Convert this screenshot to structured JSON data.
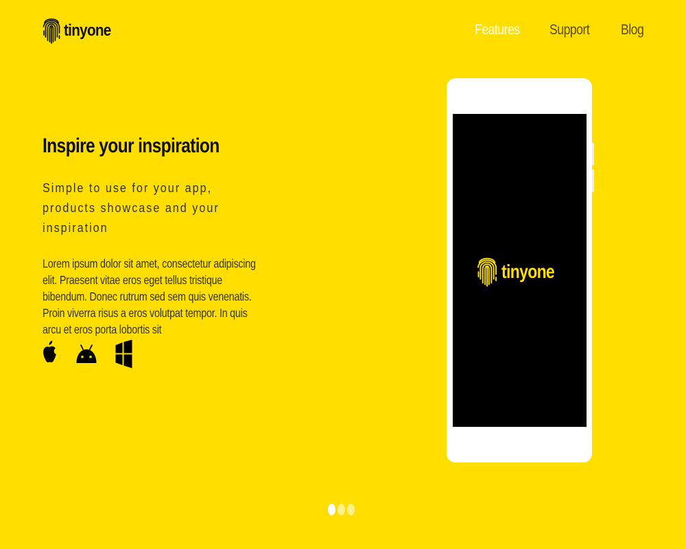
{
  "brand": {
    "name": "tinyone",
    "icon": "fingerprint-icon",
    "color": "#FFDE00"
  },
  "nav": {
    "items": [
      {
        "label": "Features",
        "active": true
      },
      {
        "label": "Support",
        "active": false
      },
      {
        "label": "Blog",
        "active": false
      }
    ]
  },
  "hero": {
    "title": "Inspire your inspiration",
    "subtitle": "Simple to use for your app, products showcase and your inspiration",
    "body": "Lorem ipsum dolor sit amet, consectetur adipiscing elit. Praesent vitae eros eget tellus tristique bibendum. Donec rutrum sed sem quis venenatis. Proin viverra risus a eros volutpat tempor. In quis arcu et eros porta lobortis sit"
  },
  "platforms": [
    {
      "icon": "apple-icon"
    },
    {
      "icon": "android-icon"
    },
    {
      "icon": "windows-icon"
    }
  ],
  "phone": {
    "screen_brand": "tinyone",
    "screen_background": "#000000",
    "frame_color": "#FFFFFF"
  },
  "carousel": {
    "count": 3,
    "active_index": 0
  },
  "colors": {
    "background": "#FFDE00",
    "nav_active": "#FFFFFF",
    "nav_inactive": "#5A4D00",
    "text": "#111111"
  }
}
